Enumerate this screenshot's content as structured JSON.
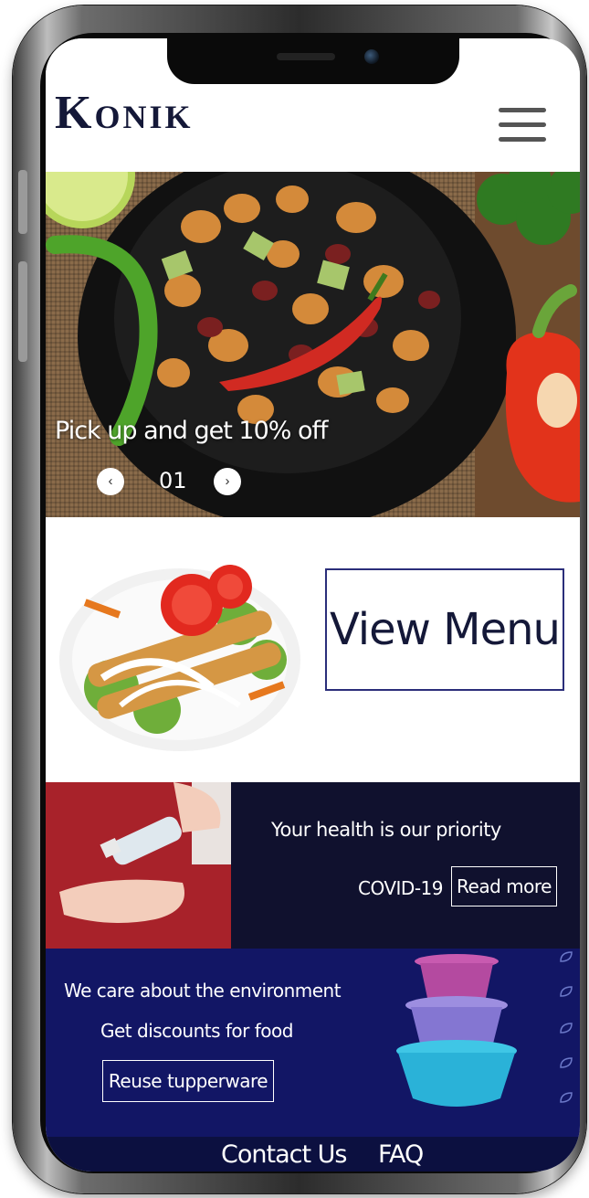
{
  "header": {
    "logo": "Konik",
    "menu_icon": "hamburger-menu-icon"
  },
  "hero": {
    "promo_text": "Pick up and get 10% off",
    "slide_number": "01",
    "prev_icon": "chevron-left-icon",
    "next_icon": "chevron-right-icon",
    "prev_glyph": "‹",
    "next_glyph": "›"
  },
  "menu_section": {
    "button_label": "View Menu"
  },
  "health": {
    "title": "Your health is our priority",
    "tag": "COVID-19",
    "button_label": "Read more"
  },
  "environment": {
    "line1": "We care about the environment",
    "line2": "Get discounts for food",
    "button_label": "Reuse tupperware"
  },
  "footer": {
    "links": [
      {
        "label": "Contact Us"
      },
      {
        "label": "FAQ"
      }
    ]
  },
  "colors": {
    "brand_navy": "#141838",
    "health_bg": "#10112e",
    "environment_bg": "#121665",
    "footer_bg": "#0c1040",
    "button_border": "#2b2e7a"
  }
}
